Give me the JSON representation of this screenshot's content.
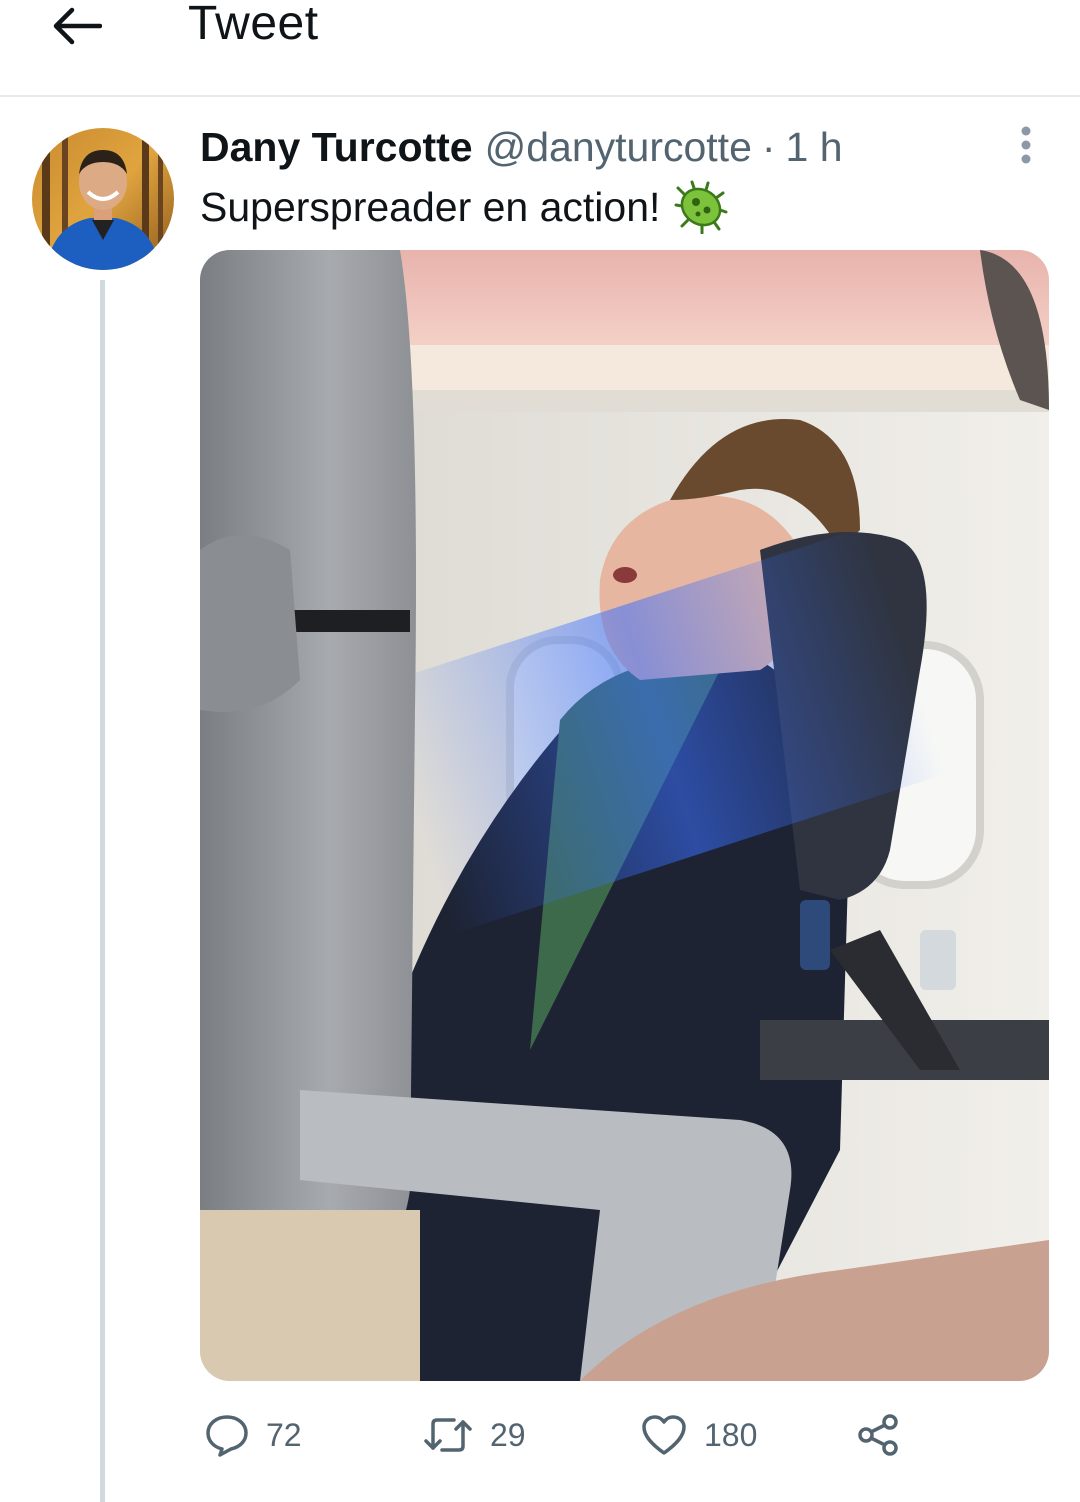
{
  "header": {
    "back_icon": "arrow-left-icon",
    "title": "Tweet"
  },
  "tweet": {
    "author_name": "Dany Turcotte",
    "author_handle": "@danyturcotte",
    "separator": "·",
    "timestamp": "1 h",
    "text": "Superspreader en action!",
    "emoji": "microbe-emoji",
    "more_icon": "more-vertical-icon",
    "media_description": "photo-airplane-passenger-sleeping"
  },
  "actions": {
    "replies": "72",
    "retweets": "29",
    "likes": "180",
    "reply_icon": "reply-bubble-icon",
    "retweet_icon": "retweet-icon",
    "like_icon": "heart-icon",
    "share_icon": "share-icon"
  },
  "colors": {
    "text_primary": "#0f1419",
    "text_secondary": "#536471",
    "divider": "#e6e9eb",
    "thread_line": "#cfd9de"
  }
}
